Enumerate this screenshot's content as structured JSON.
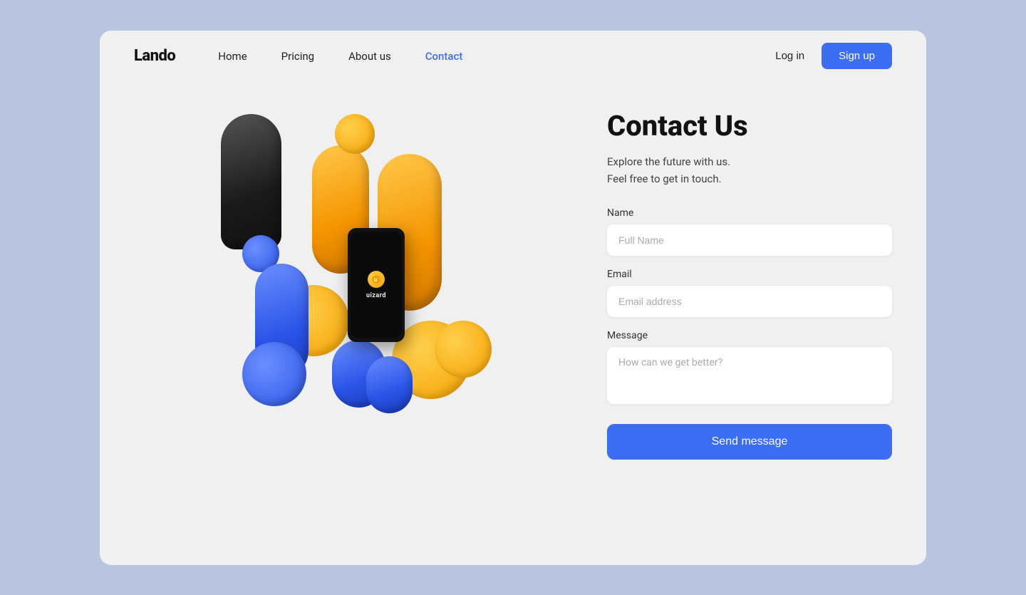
{
  "brand": {
    "logo": "Lando"
  },
  "navbar": {
    "links": [
      {
        "label": "Home",
        "active": false
      },
      {
        "label": "Pricing",
        "active": false
      },
      {
        "label": "About us",
        "active": false
      },
      {
        "label": "Contact",
        "active": true
      }
    ],
    "login_label": "Log in",
    "signup_label": "Sign up"
  },
  "contact": {
    "title": "Contact Us",
    "subtitle_line1": "Explore the future with us.",
    "subtitle_line2": "Feel free to get in touch.",
    "fields": {
      "name_label": "Name",
      "name_placeholder": "Full Name",
      "email_label": "Email",
      "email_placeholder": "Email address",
      "message_label": "Message",
      "message_placeholder": "How can we get better?"
    },
    "send_label": "Send message"
  },
  "phone": {
    "brand_text": "uizard"
  },
  "colors": {
    "accent_blue": "#3b6ef5",
    "orange": "#f5a000",
    "blue_blob": "#2b55e8",
    "background": "#b8c4e0",
    "card_bg": "#f0f0f0"
  }
}
